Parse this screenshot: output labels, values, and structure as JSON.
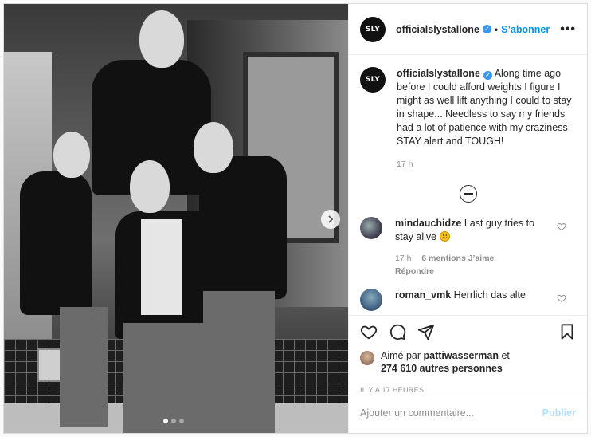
{
  "post": {
    "author": "officialslystallone",
    "avatar_text": "SLY",
    "follow_label": "S’abonner",
    "separator": "•",
    "more_label": "•••"
  },
  "caption": {
    "username": "officialslystallone",
    "text": "Along time ago before I could afford weights I figure I might as well lift anything I could to stay in shape... Needless to say my friends had a lot of patience with my craziness! STAY alert and TOUGH!",
    "time": "17 h"
  },
  "comments": [
    {
      "username": "mindauchidze",
      "text": "Last guy tries to stay alive",
      "emoji": "smiling-face",
      "time": "17 h",
      "likes": "6 mentions J’aime",
      "reply_label": "Répondre"
    },
    {
      "username": "roman_vmk",
      "text": "Herrlich das alte"
    }
  ],
  "likes": {
    "prefix": "Aimé par",
    "user": "pattiwasserman",
    "conj": "et",
    "others": "274 610 autres personnes"
  },
  "timestamp": "IL Y A 17 HEURES",
  "add_comment": {
    "placeholder": "Ajouter un commentaire...",
    "publish_label": "Publier"
  },
  "carousel": {
    "count": 3,
    "active": 1
  },
  "colors": {
    "accent": "#0095f6",
    "verified": "#3897f0",
    "muted": "#8e8e8e",
    "publish_disabled": "#b2dffc"
  }
}
